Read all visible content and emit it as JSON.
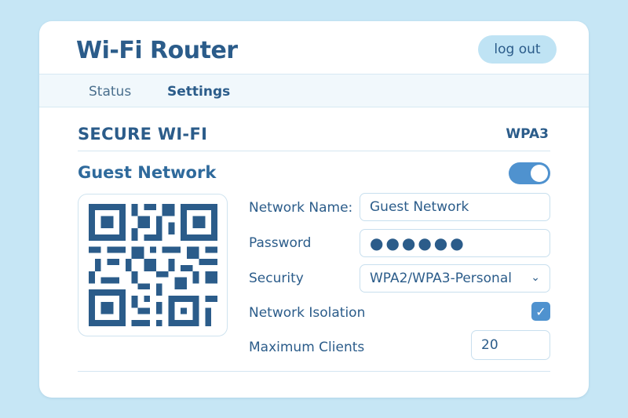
{
  "header": {
    "title": "Wi-Fi Router",
    "logout_label": "log out"
  },
  "tabs": [
    {
      "label": "Status"
    },
    {
      "label": "Settings"
    }
  ],
  "section": {
    "title": "SECURE WI-FI",
    "badge": "WPA3"
  },
  "guest": {
    "title": "Guest Network",
    "enabled": true,
    "qr_icon": "qr-code",
    "fields": {
      "name_label": "Network Name:",
      "name_value": "Guest Network",
      "password_label": "Password",
      "password_value": "●●●●●●",
      "security_label": "Security",
      "security_value": "WPA2/WPA3-Personal",
      "isolation_label": "Network Isolation",
      "isolation_checked": true,
      "max_clients_label": "Maximum Clients",
      "max_clients_value": "20"
    }
  },
  "colors": {
    "accent": "#4f92cf",
    "text": "#2b5c8a",
    "background": "#c6e6f5"
  }
}
